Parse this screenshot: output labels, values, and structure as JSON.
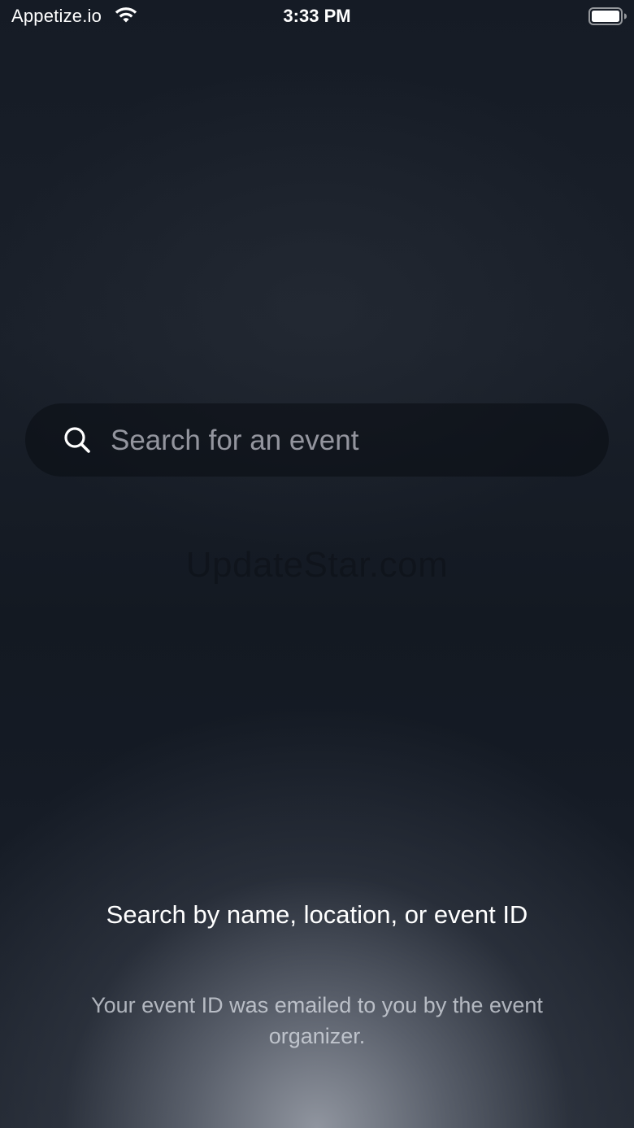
{
  "status_bar": {
    "carrier": "Appetize.io",
    "time": "3:33 PM",
    "wifi_icon": "wifi-icon",
    "battery_icon": "battery-full-icon"
  },
  "search": {
    "placeholder": "Search for an event",
    "value": "",
    "icon": "search-icon"
  },
  "watermark": "UpdateStar.com",
  "help": {
    "title": "Search by name, location, or event ID",
    "subtitle": "Your event ID was emailed to you by the event organizer."
  }
}
